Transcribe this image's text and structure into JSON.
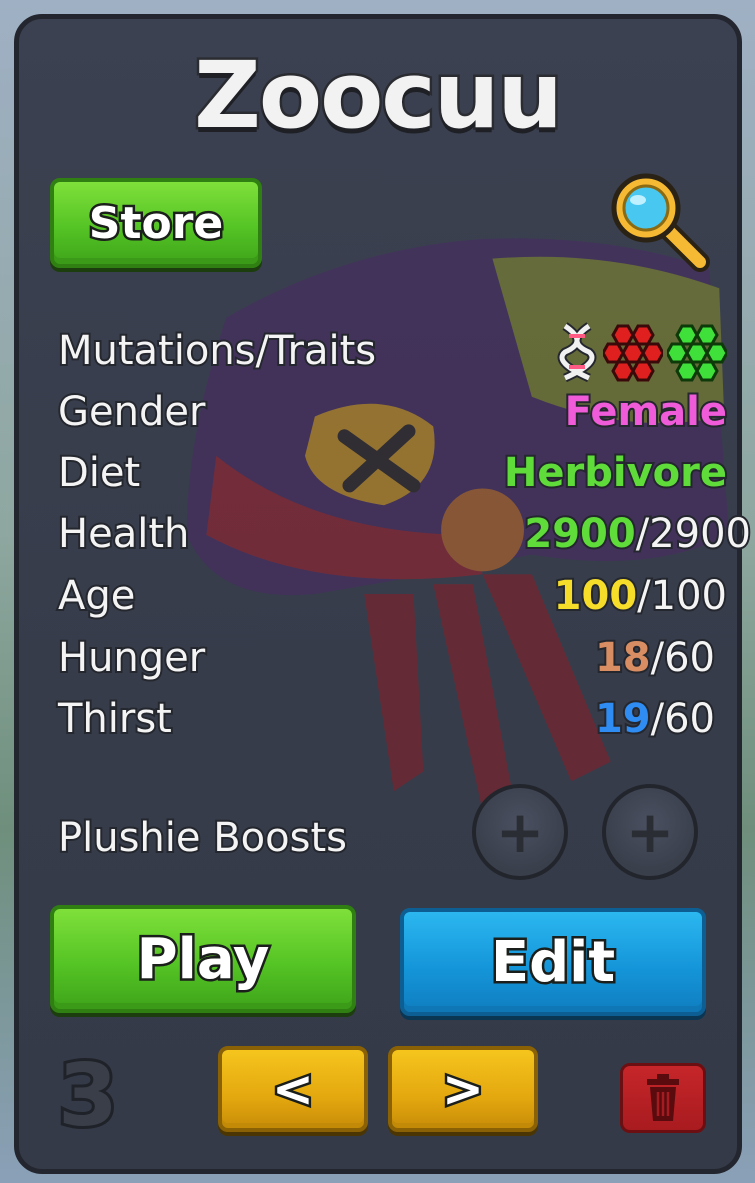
{
  "title": "Zoocuu",
  "buttons": {
    "store": "Store",
    "play": "Play",
    "edit": "Edit",
    "prev": "<",
    "next": ">"
  },
  "icons": {
    "inspect": "magnifier-icon",
    "dna": "dna-icon",
    "red_mutation": "red-hexagon-cluster-icon",
    "green_mutation": "green-hexagon-cluster-icon",
    "delete": "trash-icon"
  },
  "stats": {
    "mutations_label": "Mutations/Traits",
    "gender_label": "Gender",
    "gender_value": "Female",
    "diet_label": "Diet",
    "diet_value": "Herbivore",
    "health_label": "Health",
    "health_current": "2900",
    "health_max": "2900",
    "age_label": "Age",
    "age_current": "100",
    "age_max": "100",
    "hunger_label": "Hunger",
    "hunger_current": "18",
    "hunger_max": "60",
    "thirst_label": "Thirst",
    "thirst_current": "19",
    "thirst_max": "60",
    "separator": "/"
  },
  "plushie": {
    "label": "Plushie Boosts",
    "slot_symbol": "+"
  },
  "page_number": "3",
  "colors": {
    "female": "#ef5bd8",
    "herbivore": "#5fdc3a",
    "health": "#5fdc3a",
    "age": "#f6dd2a",
    "hunger": "#d88e62",
    "thirst": "#2f8cf2"
  }
}
